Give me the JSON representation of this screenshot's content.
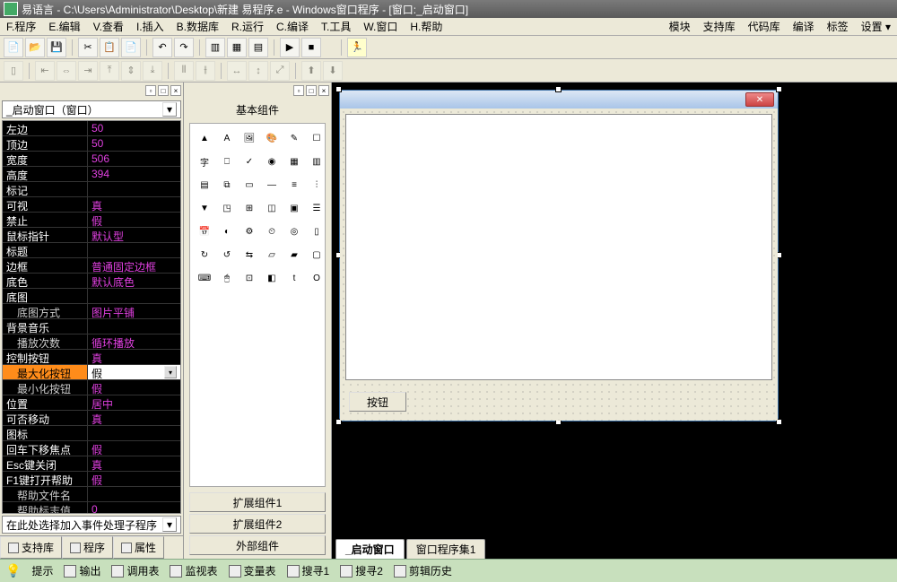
{
  "title": "易语言 - C:\\Users\\Administrator\\Desktop\\新建 易程序.e - Windows窗口程序 - [窗口:_启动窗口]",
  "menu": {
    "items": [
      "F.程序",
      "E.编辑",
      "V.查看",
      "I.插入",
      "B.数据库",
      "R.运行",
      "C.编译",
      "T.工具",
      "W.窗口",
      "H.帮助"
    ],
    "right": [
      "模块",
      "支持库",
      "代码库",
      "编译",
      "标签",
      "设置 ▾"
    ]
  },
  "left": {
    "combo": "_启动窗口（窗口）",
    "props": [
      {
        "k": "左边",
        "v": "50"
      },
      {
        "k": "顶边",
        "v": "50"
      },
      {
        "k": "宽度",
        "v": "506"
      },
      {
        "k": "高度",
        "v": "394"
      },
      {
        "k": "标记",
        "v": ""
      },
      {
        "k": "可视",
        "v": "真"
      },
      {
        "k": "禁止",
        "v": "假"
      },
      {
        "k": "鼠标指针",
        "v": "默认型"
      },
      {
        "k": "标题",
        "v": ""
      },
      {
        "k": "边框",
        "v": "普通固定边框"
      },
      {
        "k": "底色",
        "v": "默认底色"
      },
      {
        "k": "底图",
        "v": ""
      },
      {
        "k": "底图方式",
        "v": "图片平铺",
        "indent": true
      },
      {
        "k": "背景音乐",
        "v": ""
      },
      {
        "k": "播放次数",
        "v": "循环播放",
        "indent": true
      },
      {
        "k": "控制按钮",
        "v": "真"
      },
      {
        "k": "最大化按钮",
        "v": "假",
        "sel": true,
        "indent": true
      },
      {
        "k": "最小化按钮",
        "v": "假",
        "indent": true
      },
      {
        "k": "位置",
        "v": "居中"
      },
      {
        "k": "可否移动",
        "v": "真"
      },
      {
        "k": "图标",
        "v": ""
      },
      {
        "k": "回车下移焦点",
        "v": "假"
      },
      {
        "k": "Esc键关闭",
        "v": "真"
      },
      {
        "k": "F1键打开帮助",
        "v": "假"
      },
      {
        "k": "帮助文件名",
        "v": "",
        "indent": true
      },
      {
        "k": "帮助标志值",
        "v": "0",
        "indent": true
      }
    ],
    "event_combo": "在此处选择加入事件处理子程序",
    "tabs": [
      "支持库",
      "程序",
      "属性"
    ]
  },
  "mid": {
    "title": "基本组件",
    "ext": [
      "扩展组件1",
      "扩展组件2",
      "外部组件"
    ]
  },
  "design": {
    "button_label": "按钮",
    "tabs": [
      "_启动窗口",
      "窗口程序集1"
    ],
    "active_tab": 0
  },
  "status": {
    "items": [
      "提示",
      "输出",
      "调用表",
      "监视表",
      "变量表",
      "搜寻1",
      "搜寻2",
      "剪辑历史"
    ]
  }
}
